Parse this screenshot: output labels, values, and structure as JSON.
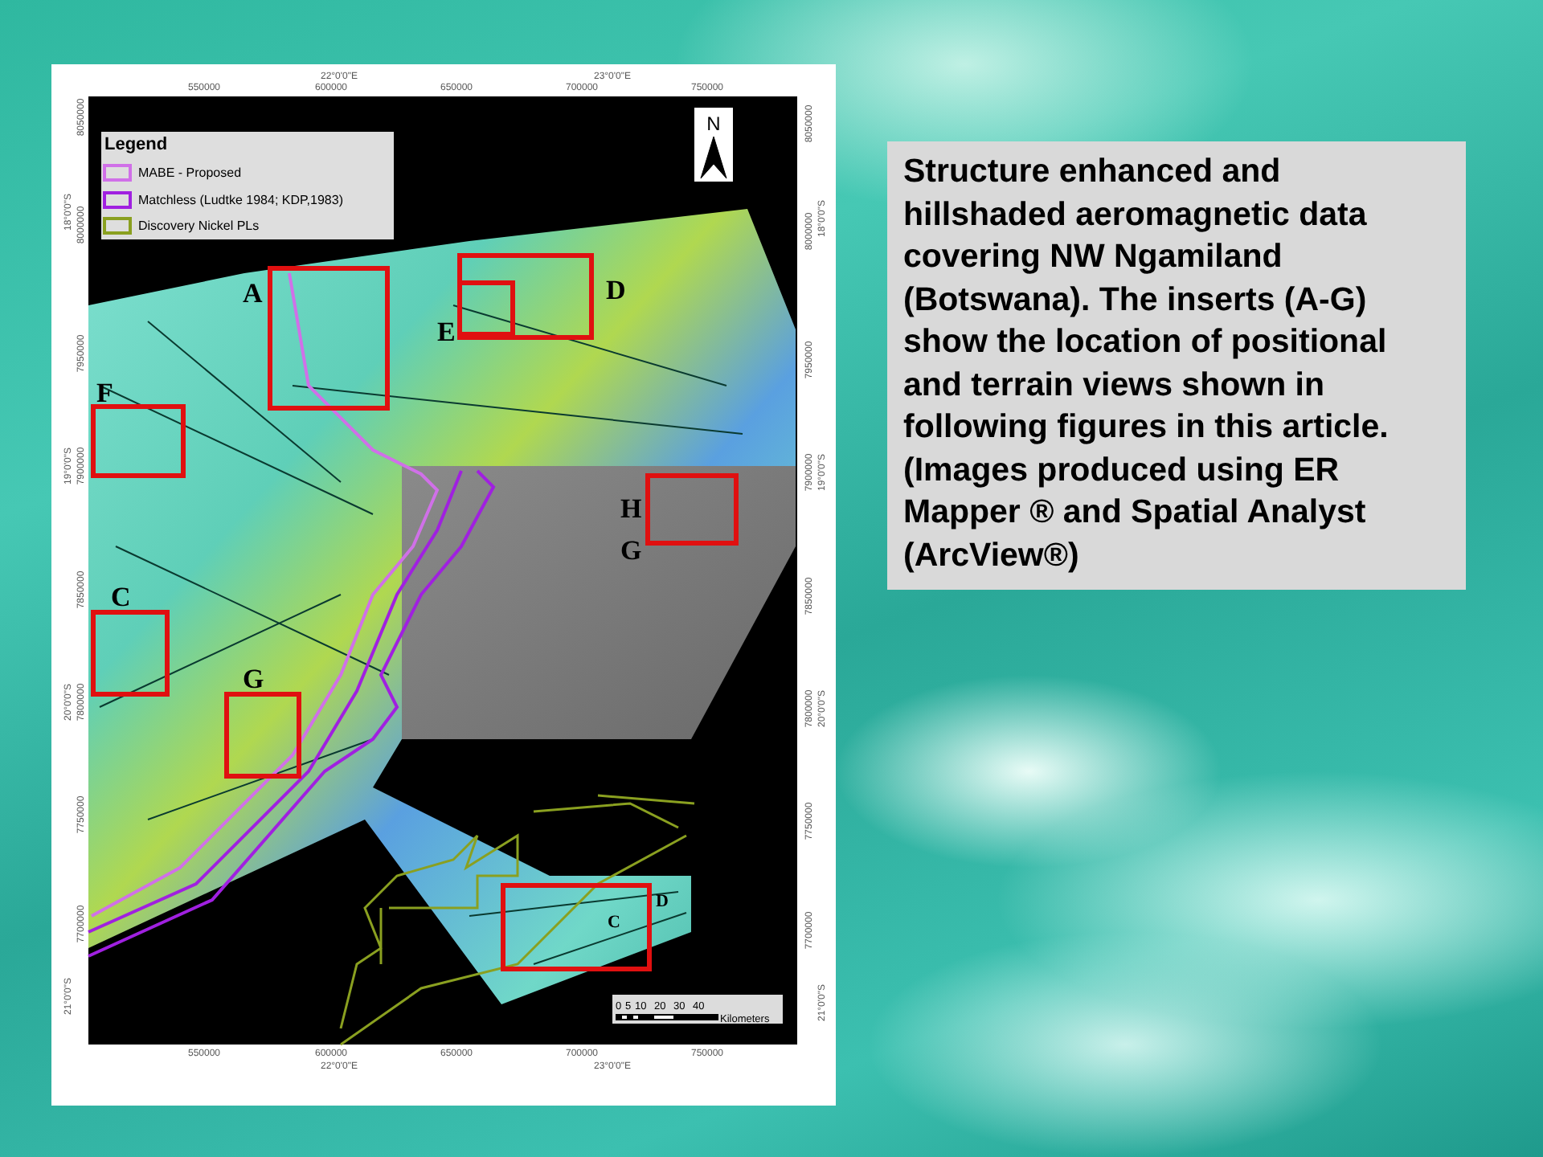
{
  "map": {
    "top_axis": {
      "eastings": [
        "550000",
        "600000",
        "650000",
        "700000",
        "750000"
      ],
      "degrees": [
        "22°0'0\"E",
        "23°0'0\"E"
      ]
    },
    "bottom_axis": {
      "eastings": [
        "550000",
        "600000",
        "650000",
        "700000",
        "750000"
      ],
      "degrees": [
        "22°0'0\"E",
        "23°0'0\"E"
      ]
    },
    "left_axis": {
      "northings": [
        "8050000",
        "8000000",
        "7950000",
        "7900000",
        "7850000",
        "7800000",
        "7750000",
        "7700000"
      ],
      "degrees": [
        "18°0'0\"S",
        "19°0'0\"S",
        "20°0'0\"S",
        "21°0'0\"S"
      ]
    },
    "right_axis": {
      "northings": [
        "8050000",
        "8000000",
        "7950000",
        "7900000",
        "7850000",
        "7800000",
        "7750000",
        "7700000"
      ],
      "degrees": [
        "18°0'0\"S",
        "19°0'0\"S",
        "20°0'0\"S",
        "21°0'0\"S"
      ]
    },
    "legend": {
      "title": "Legend",
      "items": [
        {
          "label": "MABE - Proposed",
          "color": "#d070e8"
        },
        {
          "label": "Matchless (Ludtke 1984; KDP,1983)",
          "color": "#a020e0"
        },
        {
          "label": "Discovery Nickel PLs",
          "color": "#8aa020"
        }
      ]
    },
    "north_arrow": {
      "label": "N"
    },
    "inset_labels": [
      "A",
      "E",
      "D",
      "F",
      "H",
      "G",
      "C",
      "G",
      "D",
      "C"
    ],
    "scale_bar": {
      "ticks": [
        "0",
        "5",
        "10",
        "20",
        "30",
        "40"
      ],
      "unit": "Kilometers"
    }
  },
  "caption": "Structure enhanced and hillshaded aeromagnetic data covering NW Ngamiland (Botswana). The inserts (A-G) show the location of positional and terrain views shown in following figures in this article. (Images produced using ER Mapper ® and Spatial Analyst (ArcView®)"
}
